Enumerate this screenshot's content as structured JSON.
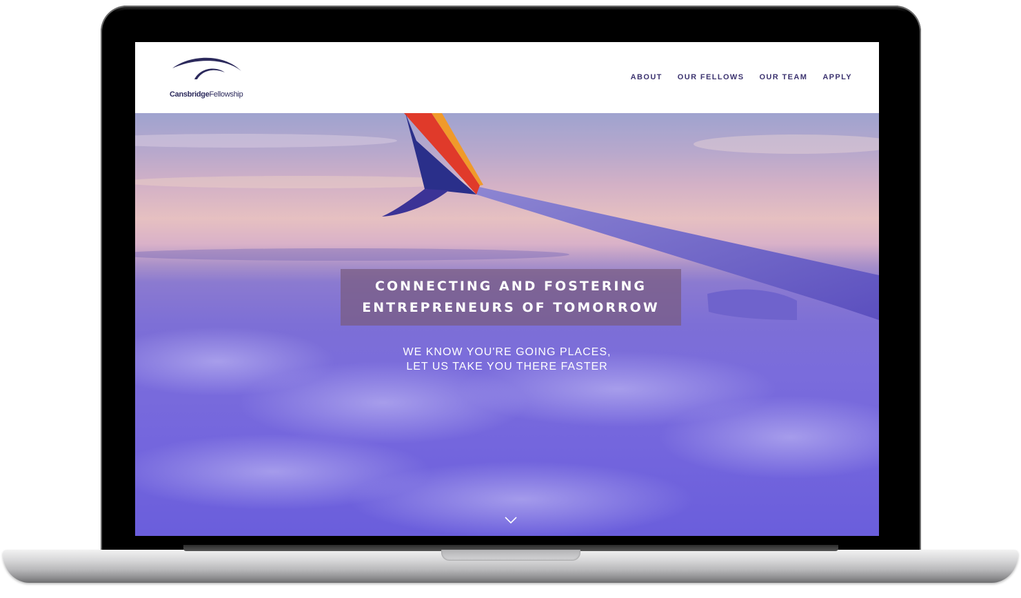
{
  "brand": {
    "name_bold": "Cansbridge",
    "name_rest": "Fellowship",
    "logo_color": "#2c2a5c"
  },
  "nav": {
    "items": [
      {
        "label": "ABOUT"
      },
      {
        "label": "OUR FELLOWS"
      },
      {
        "label": "OUR TEAM"
      },
      {
        "label": "APPLY"
      }
    ],
    "color": "#3d3470"
  },
  "hero": {
    "headline_line1": "CONNECTING AND FOSTERING",
    "headline_line2": "ENTREPRENEURS OF TOMORROW",
    "subheadline_line1": "WE KNOW YOU'RE GOING PLACES,",
    "subheadline_line2": "LET US TAKE YOU THERE FASTER",
    "scroll_icon": "chevron-down-icon"
  }
}
